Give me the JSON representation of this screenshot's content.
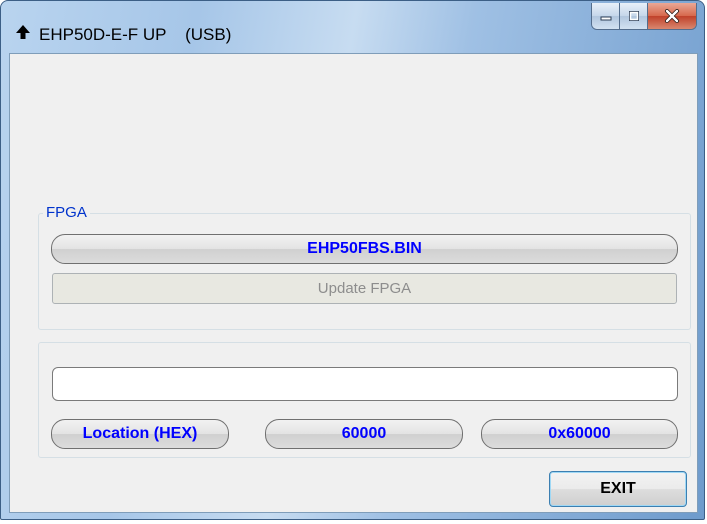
{
  "window": {
    "title": "EHP50D-E-F UP    (USB)",
    "icon": "up-arrow-icon"
  },
  "caption_buttons": {
    "minimize": "minimize-icon",
    "maximize": "maximize-icon",
    "close": "close-icon"
  },
  "fpga_group": {
    "label": "FPGA",
    "file_button": "EHP50FBS.BIN",
    "update_button": "Update FPGA",
    "update_enabled": false
  },
  "location_group": {
    "input_value": "",
    "location_label": "Location (HEX)",
    "location_decimal": "60000",
    "location_hex": "0x60000"
  },
  "footer": {
    "exit_label": "EXIT"
  },
  "colors": {
    "accent_text": "#0000ff",
    "group_label": "#0033cc",
    "disabled_text": "#8d8d8d"
  }
}
